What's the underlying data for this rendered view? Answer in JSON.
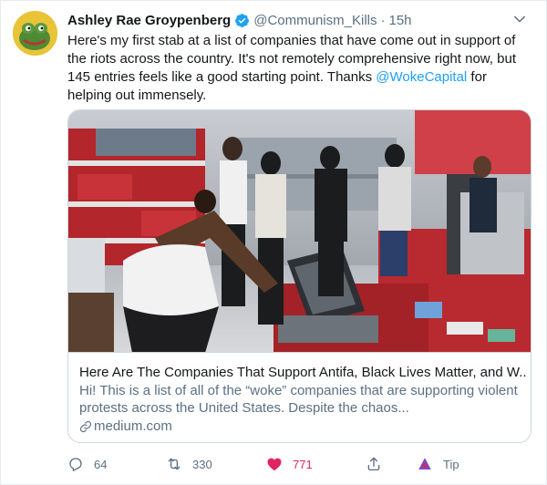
{
  "tweet": {
    "display_name": "Ashley Rae Groypenberg",
    "handle": "@Communism_Kills",
    "separator": "·",
    "time": "15h",
    "text_before": "Here's my first stab at a list of companies that have come out in support of the riots across the country. It's not remotely comprehensive right now, but 145 entries feels like a good starting point. Thanks ",
    "mention": "@WokeCapital",
    "text_after": " for helping out immensely."
  },
  "card": {
    "title": "Here Are The Companies That Support Antifa, Black Lives Matter, and W...",
    "description": "Hi! This is a list of all of the “woke” companies that are supporting violent protests across the United States. Despite the chaos...",
    "domain": "medium.com"
  },
  "actions": {
    "replies": "64",
    "retweets": "330",
    "likes": "771",
    "tip_label": "Tip"
  },
  "colors": {
    "accent": "#1da1f2",
    "like": "#e0245e",
    "muted": "#5b7083"
  }
}
